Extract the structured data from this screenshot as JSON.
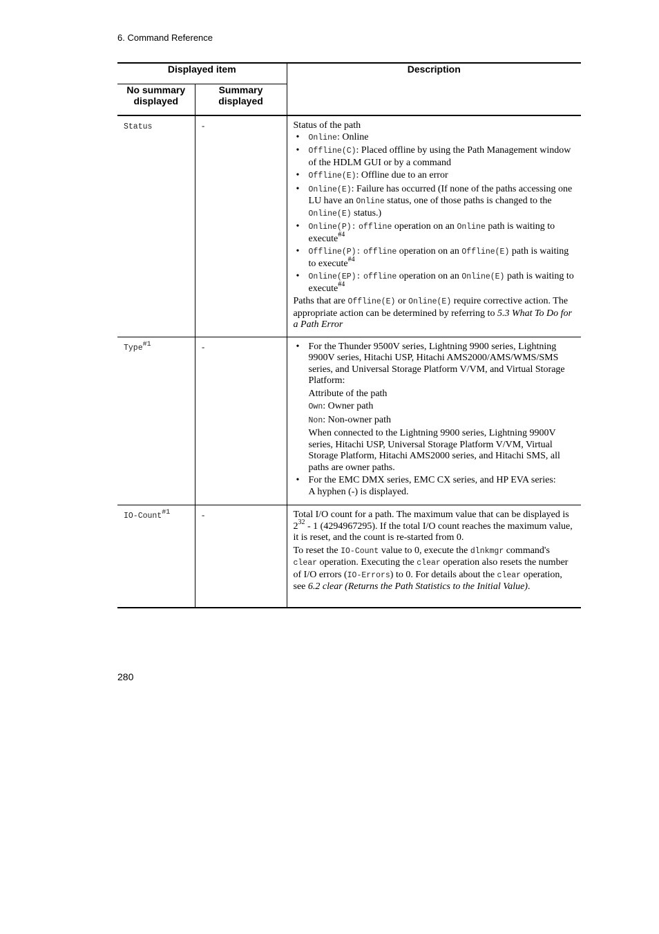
{
  "header": {
    "section": "6.  Command Reference"
  },
  "page_number": "280",
  "table": {
    "headers": {
      "displayed_item": "Displayed item",
      "description": "Description",
      "no_summary": "No summary displayed",
      "summary": "Summary displayed"
    },
    "rows": [
      {
        "item": "Status",
        "item_sup": "",
        "summary": "-",
        "status": {
          "intro": "Status of the path",
          "bullets": [
            {
              "code": "Online",
              "text": ": Online"
            },
            {
              "code": "Offline(C)",
              "text": ": Placed offline by using the Path Management window of the HDLM GUI or by a command"
            },
            {
              "code": "Offline(E)",
              "text": ": Offline due to an error"
            },
            {
              "code": "Online(E)",
              "text1": ": Failure has occurred (If none of the paths accessing one LU have an ",
              "code2": "Online",
              "text2": " status, one of those paths is changed to the ",
              "code3": "Online(E)",
              "text3": " status.)"
            },
            {
              "code": "Online(P):",
              "code_b": "offline",
              "text1": " operation on an ",
              "code2": "Online",
              "text2": " path is waiting to execute",
              "sup": "#4"
            },
            {
              "code": "Offline(P):",
              "code_b": "offline",
              "text1": " operation on an ",
              "code2": "Offline(E)",
              "text2": " path is waiting to execute",
              "sup": "#4"
            },
            {
              "code": "Online(EP):",
              "code_b": "offline",
              "text1": " operation on an ",
              "code2": "Online(E)",
              "text2": " path is waiting to execute",
              "sup": "#4"
            }
          ],
          "footer_text1": "Paths that are ",
          "footer_code1": "Offline(E)",
          "footer_text2": " or ",
          "footer_code2": "Online(E)",
          "footer_text3": " require corrective action. The appropriate action can be determined by referring to ",
          "footer_ref": "5.3  What To Do for a Path Error"
        }
      },
      {
        "item": "Type",
        "item_sup": "#1",
        "summary": "-",
        "type": {
          "bullet1": "For the Thunder 9500V series, Lightning 9900 series, Lightning 9900V series, Hitachi USP, Hitachi AMS2000/AMS/WMS/SMS series, and Universal Storage Platform V/VM, and Virtual Storage Platform:",
          "attr": "Attribute of the path",
          "own_code": "Own",
          "own_text": ": Owner path",
          "non_code": "Non",
          "non_text": ": Non-owner path",
          "note": "When connected to the Lightning 9900 series, Lightning 9900V series, Hitachi USP, Universal Storage Platform V/VM, Virtual Storage Platform, Hitachi AMS2000 series, and Hitachi SMS, all paths are owner paths.",
          "bullet2a": "For the EMC DMX series, EMC CX series, and HP EVA series:",
          "bullet2b": "A hyphen (-) is displayed."
        }
      },
      {
        "item": "IO-Count",
        "item_sup": "#1",
        "summary": "-",
        "iocount": {
          "p1_a": "Total I/O count for a path. The maximum value that can be displayed is 2",
          "p1_sup": "32",
          "p1_b": " - 1 (4294967295). If the total I/O count reaches the maximum value, it is reset, and the count is re-started from 0.",
          "p2_a": "To reset the ",
          "p2_code1": "IO-Count",
          "p2_b": " value to 0, execute the ",
          "p2_code2": "dlnkmgr",
          "p2_c": " command's ",
          "p2_code3": "clear",
          "p2_d": " operation. Executing the ",
          "p2_code4": "clear",
          "p2_e": " operation also resets the number of I/O errors (",
          "p2_code5": "IO-Errors",
          "p2_f": ") to 0. For details about the ",
          "p2_code6": "clear",
          "p2_g": " operation, see ",
          "p2_ref": "6.2  clear (Returns the Path Statistics to the Initial Value)",
          "p2_end": "."
        }
      }
    ]
  }
}
